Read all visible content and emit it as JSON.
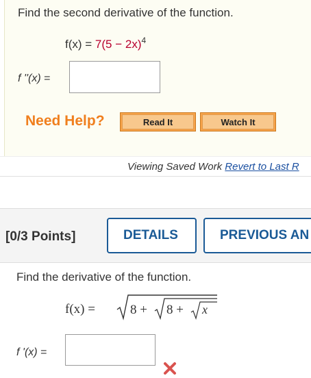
{
  "question1": {
    "prompt": "Find the second derivative of the function.",
    "formula": {
      "lhs": "f(x) = ",
      "coef": "7",
      "body": "(5 − 2x)",
      "exponent": "4"
    },
    "answer": {
      "label": "f ''(x)",
      "equals": "=",
      "value": ""
    },
    "help": {
      "label": "Need Help?",
      "read_button": "Read It",
      "watch_button": "Watch It"
    },
    "saved_status": {
      "text": "Viewing Saved Work",
      "link": "Revert to Last R"
    }
  },
  "question2": {
    "points": "[0/3 Points]",
    "details_button": "DETAILS",
    "previous_button": "PREVIOUS AN",
    "prompt": "Find the derivative of the function.",
    "formula": {
      "lhs": "f(x) = ",
      "outer_const": "8 +",
      "inner_const": "8 +",
      "variable": "x"
    },
    "answer": {
      "label": "f '(x)",
      "equals": "=",
      "value": "",
      "status": "incorrect"
    }
  },
  "colors": {
    "help_orange": "#f07f1e",
    "formula_red": "#b8002e",
    "link_blue": "#1a4fa0",
    "button_blue": "#1a5a96",
    "incorrect_red": "#d9534f"
  },
  "icons": {
    "incorrect": "close-x-icon"
  }
}
